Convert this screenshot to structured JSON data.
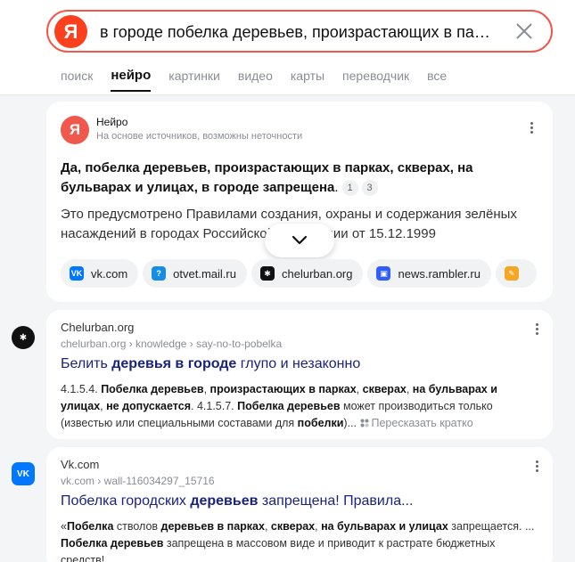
{
  "search": {
    "logo": "Я",
    "query": "в городе побелка деревьев, произрастающих в парках, скверах, на бульварах и улицах",
    "clear_label": "×"
  },
  "tabs": [
    {
      "label": "поиск",
      "active": false
    },
    {
      "label": "нейро",
      "active": true
    },
    {
      "label": "картинки",
      "active": false
    },
    {
      "label": "видео",
      "active": false
    },
    {
      "label": "карты",
      "active": false
    },
    {
      "label": "переводчик",
      "active": false
    },
    {
      "label": "все",
      "active": false
    }
  ],
  "neuro": {
    "name": "Нейро",
    "subtitle": "На основе источников, возможны неточности",
    "answer_bold": "Да, побелка деревьев, произрастающих в парках, скверах, на бульварах и улицах, в городе запрещена",
    "answer_tail": ".",
    "refs": [
      "1",
      "3"
    ],
    "text": "Это предусмотрено Правилами создания, охраны и содержания зелёных насаждений в городах Российской Федерации от 15.12.1999",
    "sources": [
      {
        "label": "vk.com",
        "icon": "vk-icon",
        "color": "#0077ff",
        "glyph": "VK"
      },
      {
        "label": "otvet.mail.ru",
        "icon": "otvet-icon",
        "color": "#168de2",
        "glyph": "?"
      },
      {
        "label": "chelurban.org",
        "icon": "chelurban-icon",
        "color": "#111111",
        "glyph": "✱"
      },
      {
        "label": "news.rambler.ru",
        "icon": "rambler-icon",
        "color": "#315efb",
        "glyph": "▣"
      },
      {
        "label": "",
        "icon": "partial-source-icon",
        "color": "#f5a623",
        "glyph": "✎"
      }
    ]
  },
  "results": [
    {
      "site": "Chelurban.org",
      "path": "chelurban.org › knowledge › say-no-to-pobelka",
      "title_parts": [
        {
          "t": "Белить ",
          "b": false
        },
        {
          "t": "деревья в городе",
          "b": true
        },
        {
          "t": " глупо и незаконно",
          "b": false
        }
      ],
      "snippet_parts": [
        {
          "t": "4.1.5.4. ",
          "b": false
        },
        {
          "t": "Побелка деревьев",
          "b": true
        },
        {
          "t": ", ",
          "b": false
        },
        {
          "t": "произрастающих в парках",
          "b": true
        },
        {
          "t": ", ",
          "b": false
        },
        {
          "t": "скверах",
          "b": true
        },
        {
          "t": ", ",
          "b": false
        },
        {
          "t": "на бульварах и улицах",
          "b": true
        },
        {
          "t": ", ",
          "b": false
        },
        {
          "t": "не допускается",
          "b": true
        },
        {
          "t": ". 4.1.5.7. ",
          "b": false
        },
        {
          "t": "Побелка деревьев",
          "b": true
        },
        {
          "t": " может производиться только (известью или специальными составами для ",
          "b": false
        },
        {
          "t": "побелки",
          "b": true
        },
        {
          "t": ")...",
          "b": false
        }
      ],
      "retell": "Пересказать кратко"
    },
    {
      "site": "Vk.com",
      "path": "vk.com › wall-116034297_15716",
      "title_parts": [
        {
          "t": "Побелка городских ",
          "b": false
        },
        {
          "t": "деревьев",
          "b": true
        },
        {
          "t": " запрещена! Правила...",
          "b": false
        }
      ],
      "snippet_parts": [
        {
          "t": "«",
          "b": false
        },
        {
          "t": "Побелка",
          "b": true
        },
        {
          "t": " стволов ",
          "b": false
        },
        {
          "t": "деревьев в парках",
          "b": true
        },
        {
          "t": ", ",
          "b": false
        },
        {
          "t": "скверах",
          "b": true
        },
        {
          "t": ", ",
          "b": false
        },
        {
          "t": "на бульварах и улицах",
          "b": true
        },
        {
          "t": " запрещается. ... ",
          "b": false
        },
        {
          "t": "Побелка деревьев",
          "b": true
        },
        {
          "t": " запрещена в массовом виде и приводит к растрате бюджетных средств!",
          "b": false
        }
      ],
      "retell": ""
    }
  ]
}
